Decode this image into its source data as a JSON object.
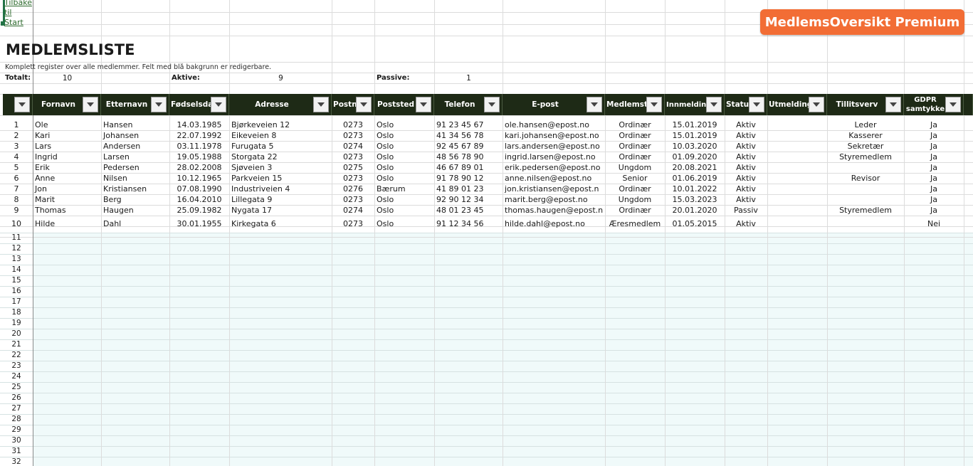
{
  "link": {
    "text": "Tilbake til Start"
  },
  "brand": {
    "label": "MedlemsOversikt Premium",
    "color": "#f26d35"
  },
  "sheet": {
    "title": "MEDLEMSLISTE",
    "subtitle": "Komplett register over alle medlemmer. Felt med blå bakgrunn er redigerbare."
  },
  "stats": {
    "total_label": "Totalt:",
    "total_value": "10",
    "active_label": "Aktive:",
    "active_value": "9",
    "passive_label": "Passive:",
    "passive_value": "1"
  },
  "table": {
    "header_color": "#1e2a16",
    "editable_fill": "#f0fafa",
    "columns": [
      {
        "key": "nr",
        "label": "",
        "align": "center"
      },
      {
        "key": "fornavn",
        "label": "Fornavn",
        "align": "left"
      },
      {
        "key": "etternavn",
        "label": "Etternavn",
        "align": "left"
      },
      {
        "key": "fodselsdato",
        "label": "Fødselsdato",
        "align": "center"
      },
      {
        "key": "adresse",
        "label": "Adresse",
        "align": "left"
      },
      {
        "key": "postnr",
        "label": "Postnr",
        "align": "center"
      },
      {
        "key": "poststed",
        "label": "Poststed",
        "align": "left"
      },
      {
        "key": "telefon",
        "label": "Telefon",
        "align": "left"
      },
      {
        "key": "epost",
        "label": "E-post",
        "align": "left"
      },
      {
        "key": "medlemstype",
        "label": "Medlemstype",
        "align": "center"
      },
      {
        "key": "innmelding",
        "label": "Innmeldingsdato",
        "align": "center"
      },
      {
        "key": "status",
        "label": "Status",
        "align": "center"
      },
      {
        "key": "utmelding",
        "label": "Utmelding",
        "align": "center"
      },
      {
        "key": "tillitsverv",
        "label": "Tillitsverv",
        "align": "center"
      },
      {
        "key": "gdpr",
        "label": "GDPR samtykke",
        "align": "center"
      }
    ],
    "rows": [
      {
        "nr": "1",
        "fornavn": "Ole",
        "etternavn": "Hansen",
        "fodselsdato": "14.03.1985",
        "adresse": "Bjørkeveien 12",
        "postnr": "0273",
        "poststed": "Oslo",
        "telefon": "91 23 45 67",
        "epost": "ole.hansen@epost.no",
        "medlemstype": "Ordinær",
        "innmelding": "15.01.2019",
        "status": "Aktiv",
        "utmelding": "",
        "tillitsverv": "Leder",
        "gdpr": "Ja"
      },
      {
        "nr": "2",
        "fornavn": "Kari",
        "etternavn": "Johansen",
        "fodselsdato": "22.07.1992",
        "adresse": "Eikeveien 8",
        "postnr": "0273",
        "poststed": "Oslo",
        "telefon": "41 34 56 78",
        "epost": "kari.johansen@epost.no",
        "medlemstype": "Ordinær",
        "innmelding": "15.01.2019",
        "status": "Aktiv",
        "utmelding": "",
        "tillitsverv": "Kasserer",
        "gdpr": "Ja"
      },
      {
        "nr": "3",
        "fornavn": "Lars",
        "etternavn": "Andersen",
        "fodselsdato": "03.11.1978",
        "adresse": "Furugata 5",
        "postnr": "0274",
        "poststed": "Oslo",
        "telefon": "92 45 67 89",
        "epost": "lars.andersen@epost.no",
        "medlemstype": "Ordinær",
        "innmelding": "10.03.2020",
        "status": "Aktiv",
        "utmelding": "",
        "tillitsverv": "Sekretær",
        "gdpr": "Ja"
      },
      {
        "nr": "4",
        "fornavn": "Ingrid",
        "etternavn": "Larsen",
        "fodselsdato": "19.05.1988",
        "adresse": "Storgata 22",
        "postnr": "0273",
        "poststed": "Oslo",
        "telefon": "48 56 78 90",
        "epost": "ingrid.larsen@epost.no",
        "medlemstype": "Ordinær",
        "innmelding": "01.09.2020",
        "status": "Aktiv",
        "utmelding": "",
        "tillitsverv": "Styremedlem",
        "gdpr": "Ja"
      },
      {
        "nr": "5",
        "fornavn": "Erik",
        "etternavn": "Pedersen",
        "fodselsdato": "28.02.2008",
        "adresse": "Sjøveien 3",
        "postnr": "0275",
        "poststed": "Oslo",
        "telefon": "46 67 89 01",
        "epost": "erik.pedersen@epost.no",
        "medlemstype": "Ungdom",
        "innmelding": "20.08.2021",
        "status": "Aktiv",
        "utmelding": "",
        "tillitsverv": "",
        "gdpr": "Ja"
      },
      {
        "nr": "6",
        "fornavn": "Anne",
        "etternavn": "Nilsen",
        "fodselsdato": "10.12.1965",
        "adresse": "Parkveien 15",
        "postnr": "0273",
        "poststed": "Oslo",
        "telefon": "91 78 90 12",
        "epost": "anne.nilsen@epost.no",
        "medlemstype": "Senior",
        "innmelding": "01.06.2019",
        "status": "Aktiv",
        "utmelding": "",
        "tillitsverv": "Revisor",
        "gdpr": "Ja"
      },
      {
        "nr": "7",
        "fornavn": "Jon",
        "etternavn": "Kristiansen",
        "fodselsdato": "07.08.1990",
        "adresse": "Industriveien 4",
        "postnr": "0276",
        "poststed": "Bærum",
        "telefon": "41 89 01 23",
        "epost": "jon.kristiansen@epost.n",
        "medlemstype": "Ordinær",
        "innmelding": "10.01.2022",
        "status": "Aktiv",
        "utmelding": "",
        "tillitsverv": "",
        "gdpr": "Ja"
      },
      {
        "nr": "8",
        "fornavn": "Marit",
        "etternavn": "Berg",
        "fodselsdato": "16.04.2010",
        "adresse": "Lillegata 9",
        "postnr": "0273",
        "poststed": "Oslo",
        "telefon": "92 90 12 34",
        "epost": "marit.berg@epost.no",
        "medlemstype": "Ungdom",
        "innmelding": "15.03.2023",
        "status": "Aktiv",
        "utmelding": "",
        "tillitsverv": "",
        "gdpr": "Ja"
      },
      {
        "nr": "9",
        "fornavn": "Thomas",
        "etternavn": "Haugen",
        "fodselsdato": "25.09.1982",
        "adresse": "Nygata 17",
        "postnr": "0274",
        "poststed": "Oslo",
        "telefon": "48 01 23 45",
        "epost": "thomas.haugen@epost.n",
        "medlemstype": "Ordinær",
        "innmelding": "20.01.2020",
        "status": "Passiv",
        "utmelding": "",
        "tillitsverv": "Styremedlem",
        "gdpr": "Ja"
      },
      {
        "nr": "10",
        "fornavn": "Hilde",
        "etternavn": "Dahl",
        "fodselsdato": "30.01.1955",
        "adresse": "Kirkegata 6",
        "postnr": "0273",
        "poststed": "Oslo",
        "telefon": "91 12 34 56",
        "epost": "hilde.dahl@epost.no",
        "medlemstype": "Æresmedlem",
        "innmelding": "01.05.2015",
        "status": "Aktiv",
        "utmelding": "",
        "tillitsverv": "",
        "gdpr": "Nei"
      }
    ],
    "empty_rows": [
      "11",
      "12",
      "13",
      "14",
      "15",
      "16",
      "17",
      "18",
      "19",
      "20",
      "21",
      "22",
      "23",
      "24",
      "25",
      "26",
      "27",
      "28",
      "29",
      "30",
      "31",
      "32"
    ]
  }
}
